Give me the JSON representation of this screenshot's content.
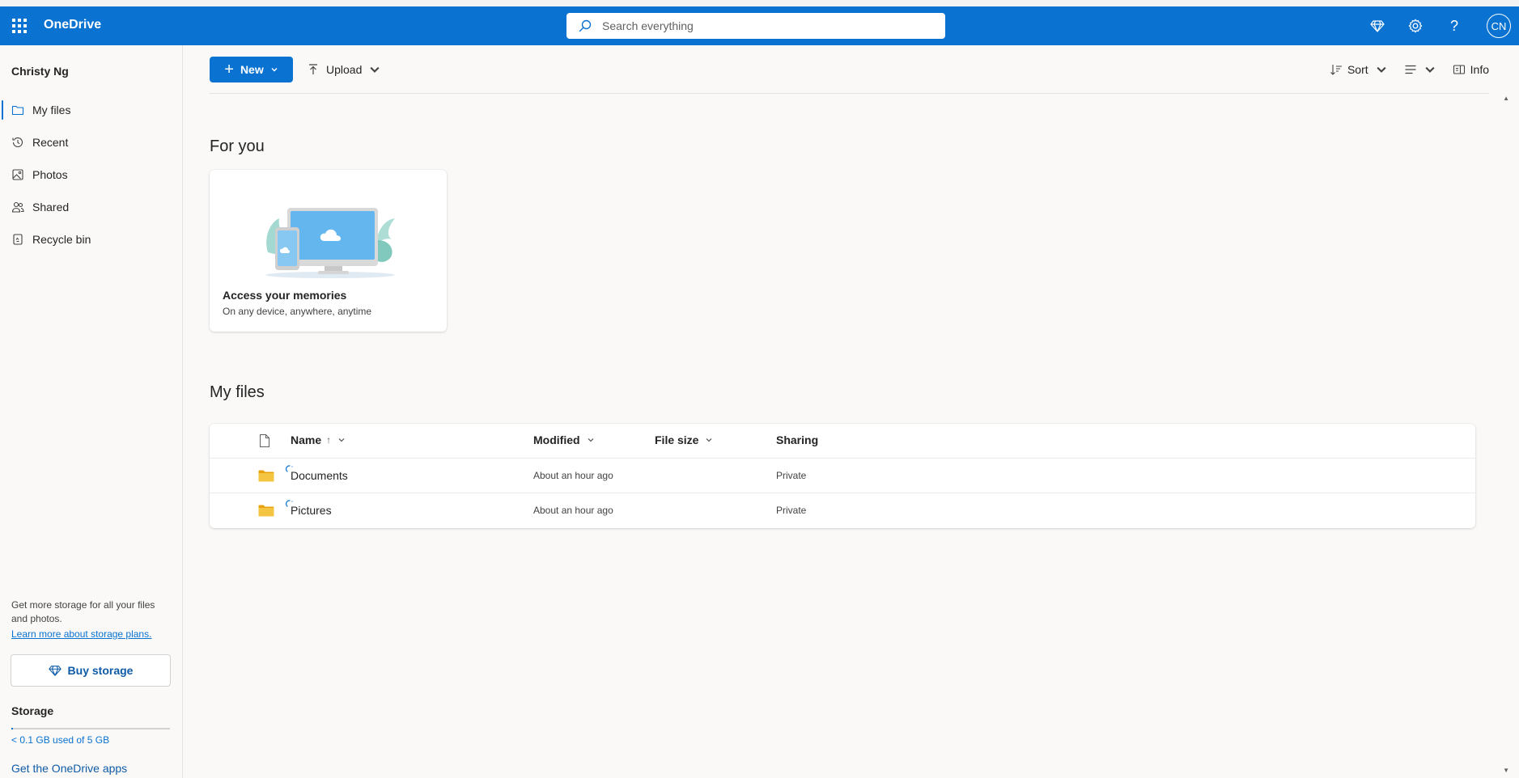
{
  "app": {
    "title": "OneDrive"
  },
  "search": {
    "placeholder": "Search everything"
  },
  "header": {
    "avatar_initials": "CN",
    "help_label": "?"
  },
  "sidebar": {
    "user_name": "Christy Ng",
    "items": [
      {
        "label": "My files",
        "icon": "folder-icon",
        "active": true
      },
      {
        "label": "Recent",
        "icon": "history-icon",
        "active": false
      },
      {
        "label": "Photos",
        "icon": "image-icon",
        "active": false
      },
      {
        "label": "Shared",
        "icon": "people-icon",
        "active": false
      },
      {
        "label": "Recycle bin",
        "icon": "recycle-bin-icon",
        "active": false
      }
    ],
    "storage_promo": "Get more storage for all your files and photos.",
    "storage_link": "Learn more about storage plans.",
    "buy_storage": "Buy storage",
    "storage_title": "Storage",
    "storage_used": "< 0.1 GB used of 5 GB",
    "storage_fraction": 0.01,
    "get_apps": "Get the OneDrive apps"
  },
  "toolbar": {
    "new_label": "New",
    "upload_label": "Upload",
    "sort_label": "Sort",
    "info_label": "Info"
  },
  "sections": {
    "for_you": "For you",
    "my_files": "My files"
  },
  "card": {
    "title": "Access your memories",
    "subtitle": "On any device, anywhere, anytime"
  },
  "table": {
    "columns": {
      "name": "Name",
      "name_sort_arrow": "↑",
      "modified": "Modified",
      "file_size": "File size",
      "sharing": "Sharing"
    },
    "rows": [
      {
        "name": "Documents",
        "modified": "About an hour ago",
        "size": "",
        "sharing": "Private"
      },
      {
        "name": "Pictures",
        "modified": "About an hour ago",
        "size": "",
        "sharing": "Private"
      }
    ]
  },
  "colors": {
    "brand": "#0a72d1",
    "folder": "#f4c542"
  }
}
